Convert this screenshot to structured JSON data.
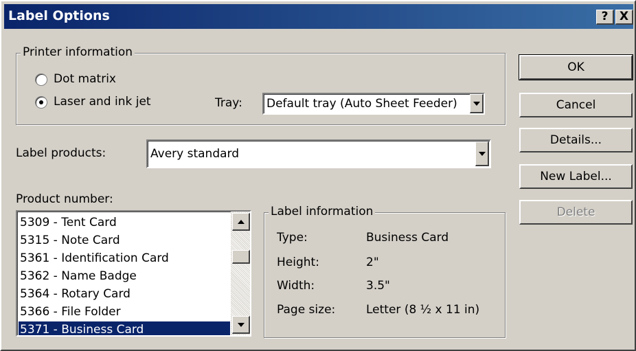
{
  "window": {
    "title": "Label Options",
    "help_btn": "?",
    "close_btn": "X"
  },
  "printer_info": {
    "legend": "Printer information",
    "radio_dot_matrix": "Dot matrix",
    "radio_laser": "Laser and ink jet",
    "selected": "Laser and ink jet",
    "tray_label": "Tray:",
    "tray_value": "Default tray (Auto Sheet Feeder)"
  },
  "label_products": {
    "label": "Label products:",
    "value": "Avery standard"
  },
  "product_number": {
    "label": "Product number:",
    "items": [
      "5309 - Tent Card",
      "5315 - Note Card",
      "5361 - Identification Card",
      "5362 - Name Badge",
      "5364 - Rotary Card",
      "5366 - File Folder",
      "5371 - Business Card"
    ],
    "selected": "5371 - Business Card"
  },
  "label_info": {
    "legend": "Label information",
    "type_label": "Type:",
    "type_value": "Business Card",
    "height_label": "Height:",
    "height_value": "2\"",
    "width_label": "Width:",
    "width_value": "3.5\"",
    "page_label": "Page size:",
    "page_value": "Letter (8 ½ x 11 in)"
  },
  "buttons": {
    "ok": "OK",
    "cancel": "Cancel",
    "details": "Details...",
    "new_label": "New Label...",
    "delete": "Delete"
  },
  "colors": {
    "face": "#d4d0c8",
    "title_start": "#0a246a",
    "title_end": "#3a6ea5",
    "selection": "#0a246a"
  }
}
